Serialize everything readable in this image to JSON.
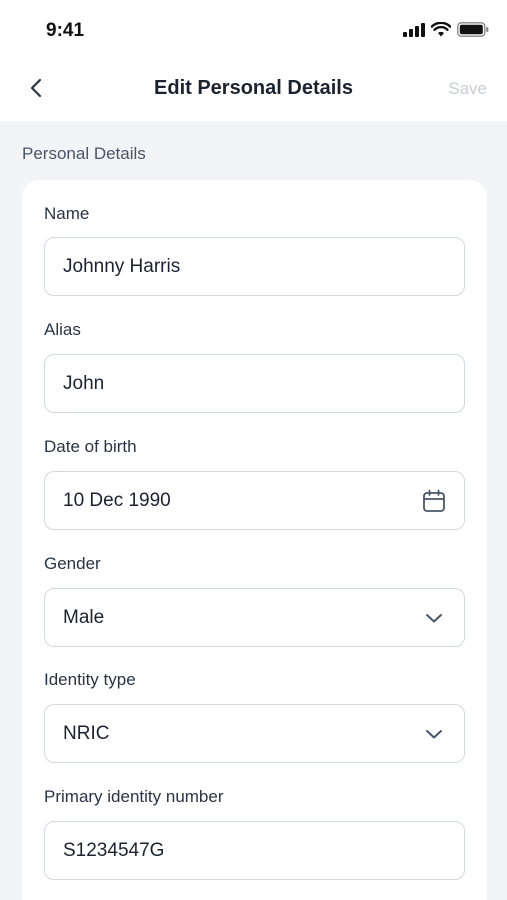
{
  "status_bar": {
    "time": "9:41",
    "icons": [
      "signal-icon",
      "wifi-icon",
      "battery-icon"
    ]
  },
  "nav": {
    "back_icon": "chevron-left-icon",
    "title": "Edit Personal Details",
    "save_label": "Save"
  },
  "section": {
    "label": "Personal Details"
  },
  "form": {
    "name": {
      "label": "Name",
      "value": "Johnny Harris"
    },
    "alias": {
      "label": "Alias",
      "value": "John"
    },
    "dob": {
      "label": "Date of birth",
      "value": "10 Dec 1990",
      "icon": "calendar-icon"
    },
    "gender": {
      "label": "Gender",
      "value": "Male",
      "icon": "chevron-down-icon"
    },
    "identity_type": {
      "label": "Identity type",
      "value": "NRIC",
      "icon": "chevron-down-icon"
    },
    "identity_number": {
      "label": "Primary identity number",
      "value": "S1234547G"
    }
  },
  "colors": {
    "background": "#f2f4f7",
    "card": "#ffffff",
    "border": "#d3d8e0",
    "text": "#1c2230",
    "save_disabled": "#c9ced6"
  }
}
